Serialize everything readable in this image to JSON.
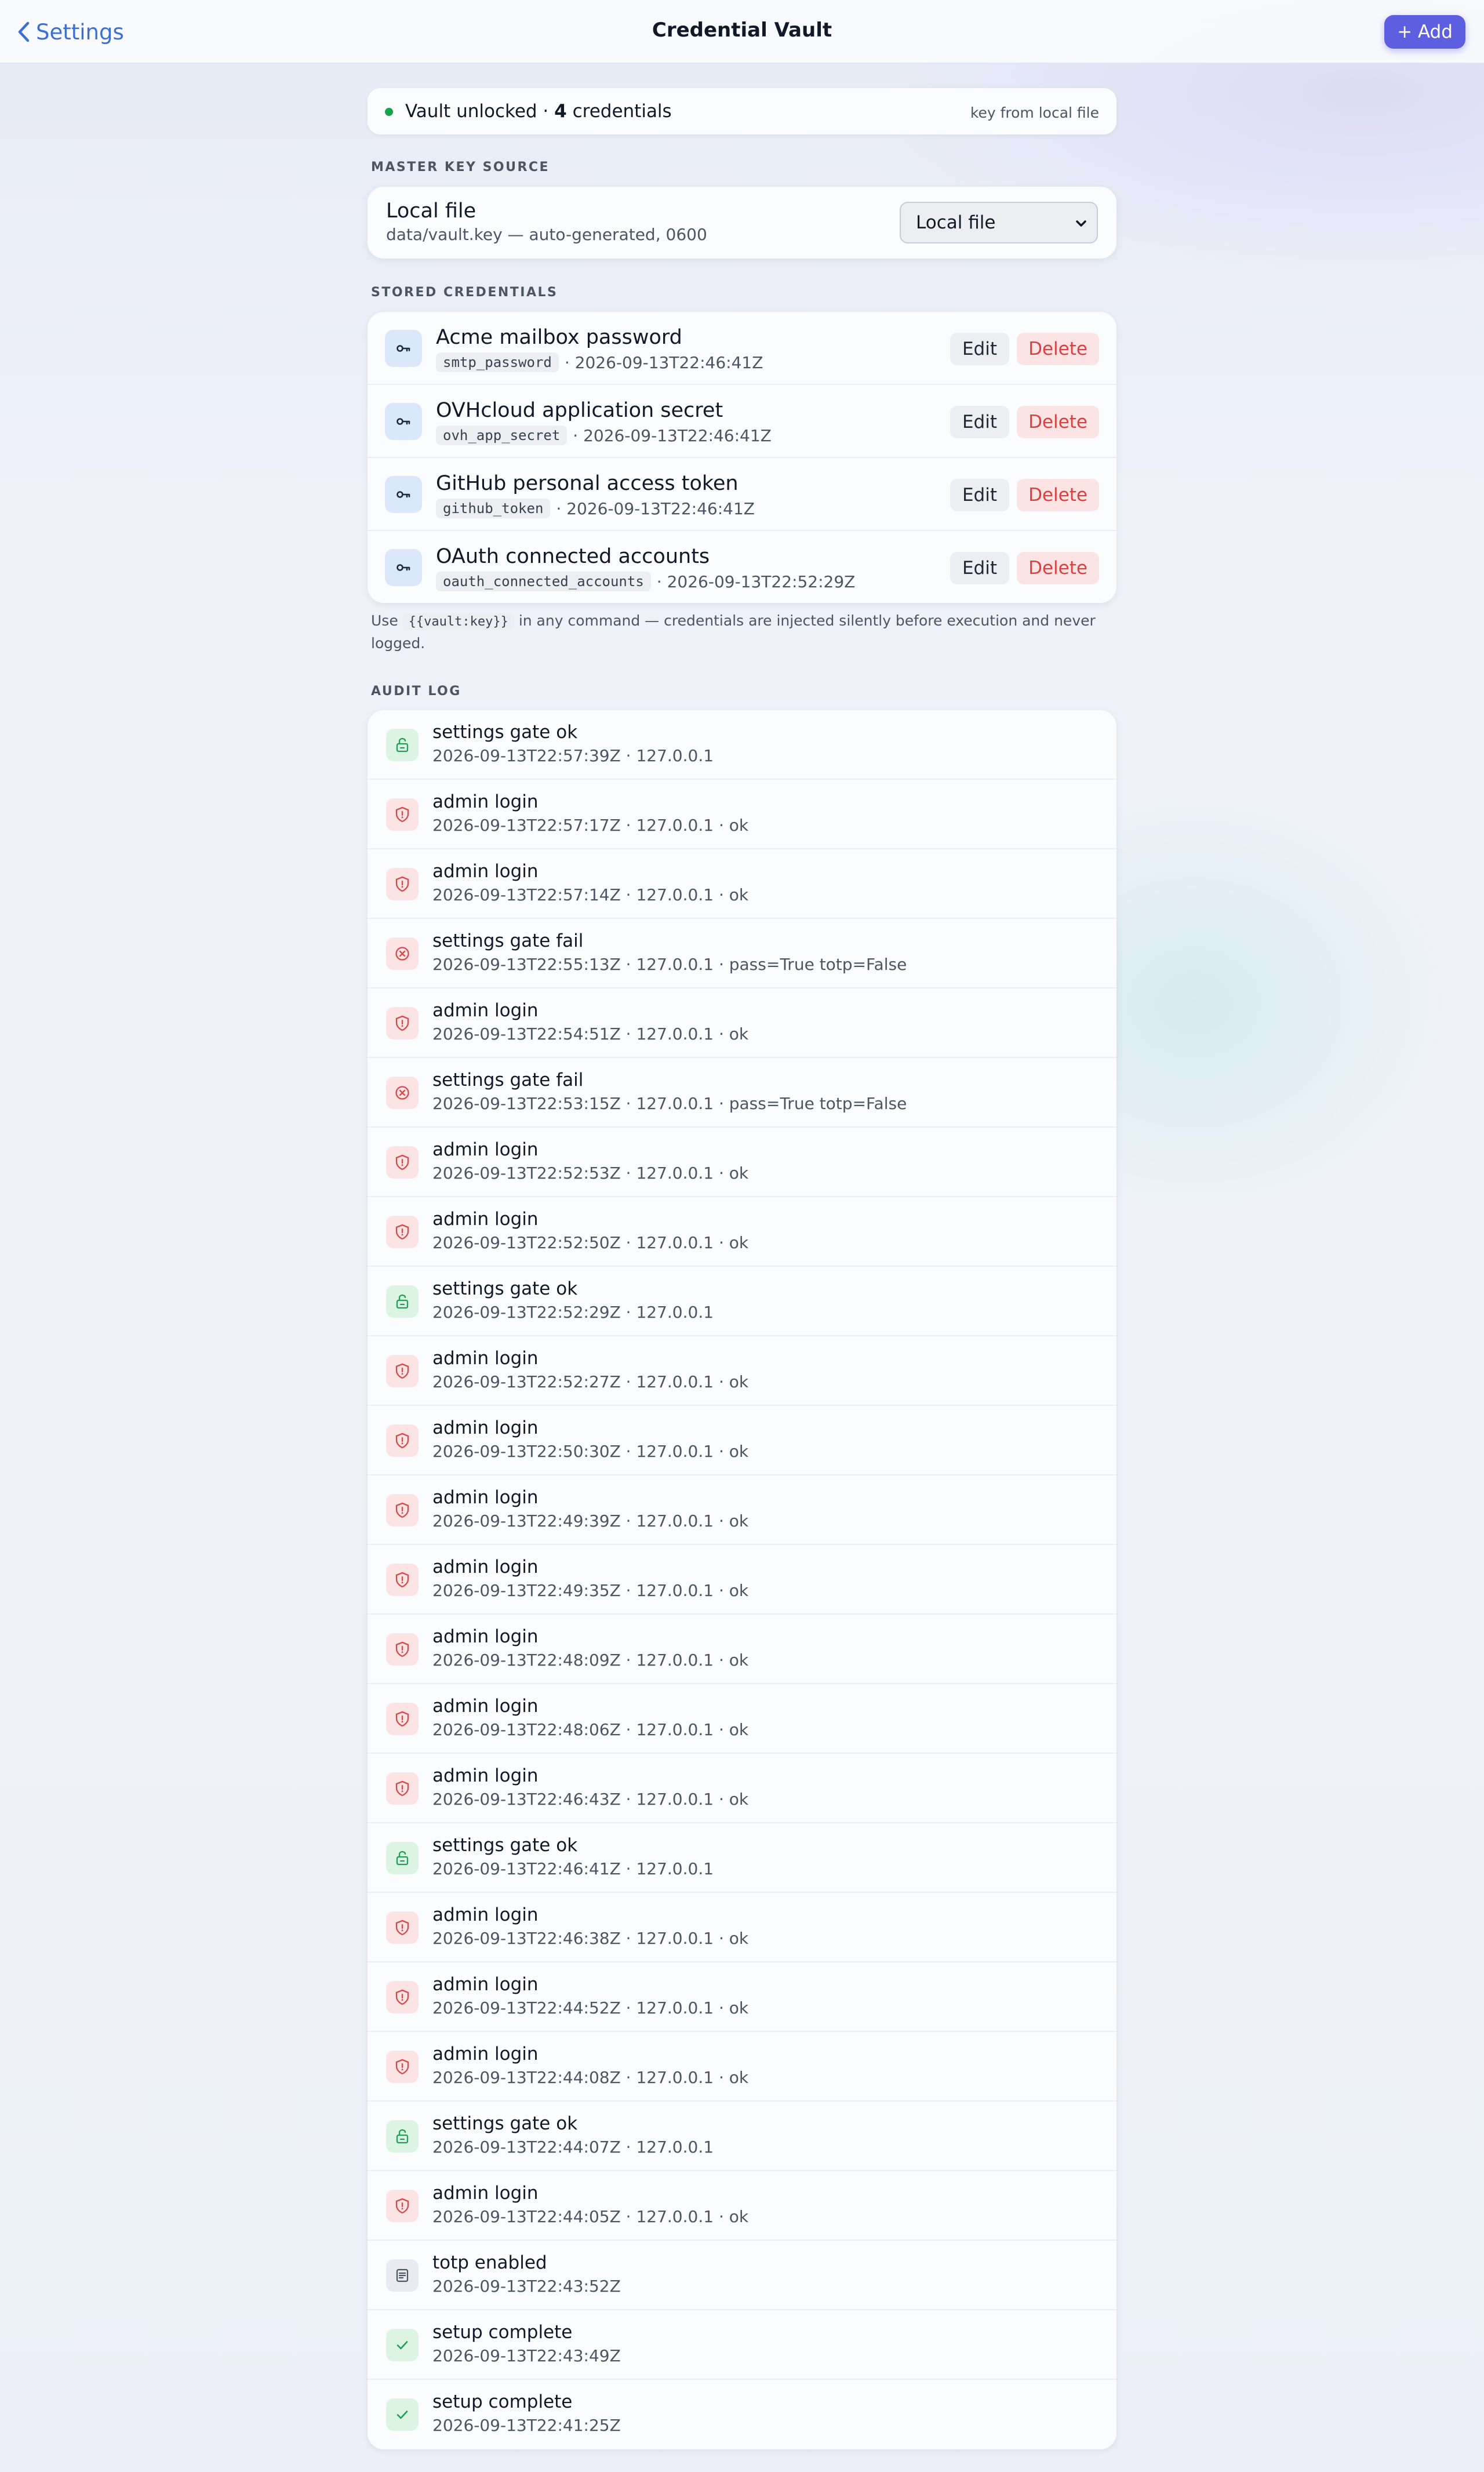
{
  "nav": {
    "back_label": "Settings",
    "title": "Credential Vault",
    "add_label": "+ Add"
  },
  "status": {
    "prefix": "Vault unlocked ·",
    "count": "4",
    "suffix": "credentials",
    "key_source_note": "key from local file",
    "dot_color": "#17a34a"
  },
  "master_key": {
    "section_label": "MASTER KEY SOURCE",
    "title": "Local file",
    "subtitle": "data/vault.key — auto-generated, 0600",
    "select_value": "Local file"
  },
  "credentials": {
    "section_label": "STORED CREDENTIALS",
    "edit_label": "Edit",
    "delete_label": "Delete",
    "items": [
      {
        "name": "Acme mailbox password",
        "key": "smtp_password",
        "updated": "· 2026-09-13T22:46:41Z"
      },
      {
        "name": "OVHcloud application secret",
        "key": "ovh_app_secret",
        "updated": "· 2026-09-13T22:46:41Z"
      },
      {
        "name": "GitHub personal access token",
        "key": "github_token",
        "updated": "· 2026-09-13T22:46:41Z"
      },
      {
        "name": "OAuth connected accounts",
        "key": "oauth_connected_accounts",
        "updated": "· 2026-09-13T22:52:29Z"
      }
    ]
  },
  "hint": {
    "before": "Use",
    "code": "{{vault:key}}",
    "after": "in any command — credentials are injected silently before execution and never logged."
  },
  "audit": {
    "section_label": "AUDIT LOG",
    "entries": [
      {
        "title": "settings gate ok",
        "meta": "2026-09-13T22:57:39Z · 127.0.0.1",
        "icon": "lock-open-icon",
        "tone": "green"
      },
      {
        "title": "admin login",
        "meta": "2026-09-13T22:57:17Z · 127.0.0.1 · ok",
        "icon": "shield-alert-icon",
        "tone": "red"
      },
      {
        "title": "admin login",
        "meta": "2026-09-13T22:57:14Z · 127.0.0.1 · ok",
        "icon": "shield-alert-icon",
        "tone": "red"
      },
      {
        "title": "settings gate fail",
        "meta": "2026-09-13T22:55:13Z · 127.0.0.1 · pass=True totp=False",
        "icon": "x-circle-icon",
        "tone": "red"
      },
      {
        "title": "admin login",
        "meta": "2026-09-13T22:54:51Z · 127.0.0.1 · ok",
        "icon": "shield-alert-icon",
        "tone": "red"
      },
      {
        "title": "settings gate fail",
        "meta": "2026-09-13T22:53:15Z · 127.0.0.1 · pass=True totp=False",
        "icon": "x-circle-icon",
        "tone": "red"
      },
      {
        "title": "admin login",
        "meta": "2026-09-13T22:52:53Z · 127.0.0.1 · ok",
        "icon": "shield-alert-icon",
        "tone": "red"
      },
      {
        "title": "admin login",
        "meta": "2026-09-13T22:52:50Z · 127.0.0.1 · ok",
        "icon": "shield-alert-icon",
        "tone": "red"
      },
      {
        "title": "settings gate ok",
        "meta": "2026-09-13T22:52:29Z · 127.0.0.1",
        "icon": "lock-open-icon",
        "tone": "green"
      },
      {
        "title": "admin login",
        "meta": "2026-09-13T22:52:27Z · 127.0.0.1 · ok",
        "icon": "shield-alert-icon",
        "tone": "red"
      },
      {
        "title": "admin login",
        "meta": "2026-09-13T22:50:30Z · 127.0.0.1 · ok",
        "icon": "shield-alert-icon",
        "tone": "red"
      },
      {
        "title": "admin login",
        "meta": "2026-09-13T22:49:39Z · 127.0.0.1 · ok",
        "icon": "shield-alert-icon",
        "tone": "red"
      },
      {
        "title": "admin login",
        "meta": "2026-09-13T22:49:35Z · 127.0.0.1 · ok",
        "icon": "shield-alert-icon",
        "tone": "red"
      },
      {
        "title": "admin login",
        "meta": "2026-09-13T22:48:09Z · 127.0.0.1 · ok",
        "icon": "shield-alert-icon",
        "tone": "red"
      },
      {
        "title": "admin login",
        "meta": "2026-09-13T22:48:06Z · 127.0.0.1 · ok",
        "icon": "shield-alert-icon",
        "tone": "red"
      },
      {
        "title": "admin login",
        "meta": "2026-09-13T22:46:43Z · 127.0.0.1 · ok",
        "icon": "shield-alert-icon",
        "tone": "red"
      },
      {
        "title": "settings gate ok",
        "meta": "2026-09-13T22:46:41Z · 127.0.0.1",
        "icon": "lock-open-icon",
        "tone": "green"
      },
      {
        "title": "admin login",
        "meta": "2026-09-13T22:46:38Z · 127.0.0.1 · ok",
        "icon": "shield-alert-icon",
        "tone": "red"
      },
      {
        "title": "admin login",
        "meta": "2026-09-13T22:44:52Z · 127.0.0.1 · ok",
        "icon": "shield-alert-icon",
        "tone": "red"
      },
      {
        "title": "admin login",
        "meta": "2026-09-13T22:44:08Z · 127.0.0.1 · ok",
        "icon": "shield-alert-icon",
        "tone": "red"
      },
      {
        "title": "settings gate ok",
        "meta": "2026-09-13T22:44:07Z · 127.0.0.1",
        "icon": "lock-open-icon",
        "tone": "green"
      },
      {
        "title": "admin login",
        "meta": "2026-09-13T22:44:05Z · 127.0.0.1 · ok",
        "icon": "shield-alert-icon",
        "tone": "red"
      },
      {
        "title": "totp enabled",
        "meta": "2026-09-13T22:43:52Z",
        "icon": "document-icon",
        "tone": "gray"
      },
      {
        "title": "setup complete",
        "meta": "2026-09-13T22:43:49Z",
        "icon": "check-icon",
        "tone": "green"
      },
      {
        "title": "setup complete",
        "meta": "2026-09-13T22:41:25Z",
        "icon": "check-icon",
        "tone": "green"
      }
    ]
  },
  "colors": {
    "accent": "#5b5fe0",
    "link": "#3b6fd8",
    "danger": "#dc3f3f",
    "success": "#17a34a"
  }
}
